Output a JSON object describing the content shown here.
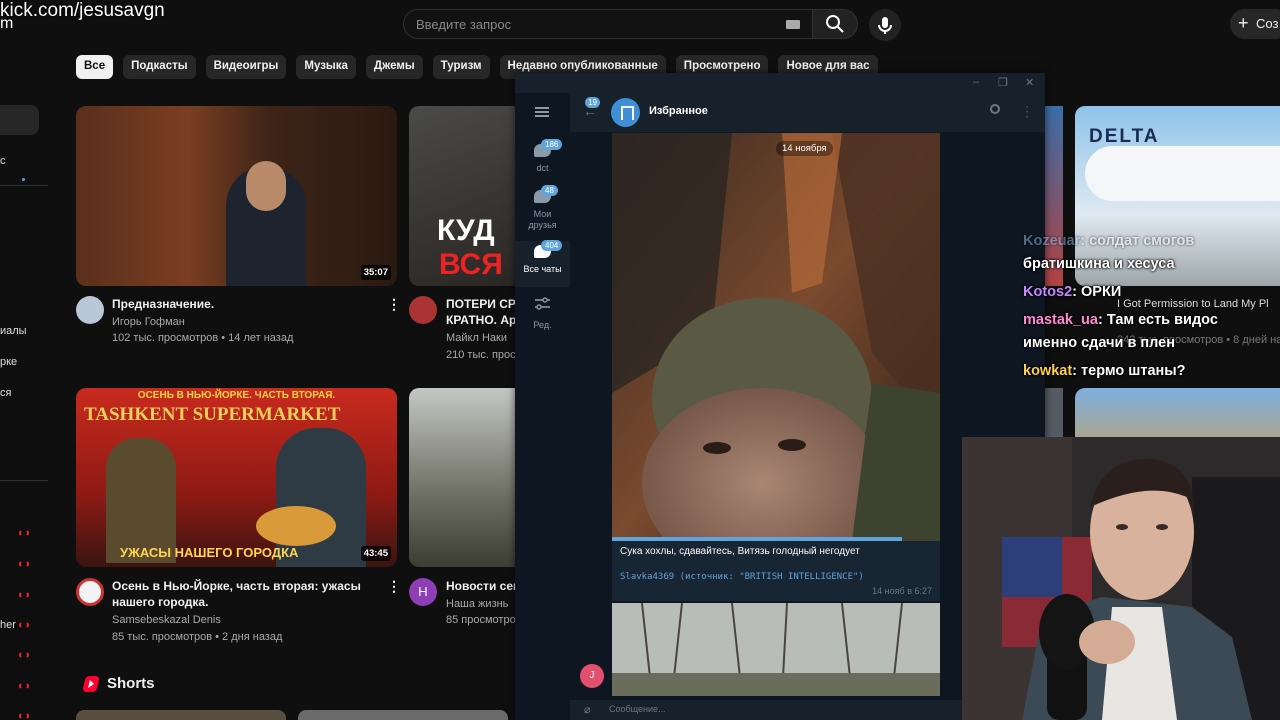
{
  "overlay": {
    "stream_url": "kick.com/jesusavgn",
    "stream_url_tail": "m"
  },
  "header": {
    "search_placeholder": "Введите запрос",
    "create_label": "Соз",
    "create_plus": "+"
  },
  "sidebar": {
    "labels": [
      "иалы",
      "рке",
      "ся",
      "her"
    ]
  },
  "chips": [
    "Все",
    "Подкасты",
    "Видеоигры",
    "Музыка",
    "Джемы",
    "Туризм",
    "Недавно опубликованные",
    "Просмотрено",
    "Новое для вас"
  ],
  "videos": [
    {
      "title": "Предназначение.",
      "channel": "Игорь Гофман",
      "meta": "102 тыс. просмотров • 14 лет назад",
      "duration": "35:07"
    },
    {
      "title": "ПОТЕРИ СРЕ",
      "title2": "КРАТНО. Арі",
      "channel": "Майкл Наки",
      "meta": "210 тыс. просм",
      "thumb_text1": "КУД",
      "thumb_text2": "ВСЯ"
    },
    {
      "title": "Осень в Нью-Йорке, часть вторая: ужасы",
      "title2": "нашего городка.",
      "channel": "Samsebeskazal Denis",
      "meta": "85 тыс. просмотров • 2 дня назад",
      "duration": "43:45",
      "thumb_top": "ОСЕНЬ В НЬЮ-ЙОРКЕ. ЧАСТЬ ВТОРАЯ.",
      "thumb_mid": "TASHKENT SUPERMARKET",
      "thumb_bottom": "УЖАСЫ НАШЕГО ГОРОДКА"
    },
    {
      "title": "Новости сег",
      "channel": "Наша жизнь",
      "meta": "85 просмотро",
      "avatar_letter": "Н"
    }
  ],
  "right_videos": [
    {
      "thumb_text": "DELTA",
      "title": "I Got Permission to Land My Pl",
      "meta": "342 тыс. просмотров • 8 дней наз"
    }
  ],
  "shorts": {
    "title": "Shorts"
  },
  "telegram": {
    "window_buttons": [
      "–",
      "❐",
      "✕"
    ],
    "folders": [
      {
        "label": "dct",
        "badge": "186"
      },
      {
        "label": "Мои друзья",
        "badge": "48"
      },
      {
        "label": "Все чаты",
        "badge": "404"
      },
      {
        "label": "Ред.",
        "badge": ""
      }
    ],
    "back_badge": "19",
    "chat_title": "Избранное",
    "date": "14 ноября",
    "message_text": "Сука хохлы, сдавайтесь, Витязь голодный негодует",
    "forward_from": "Slavka4369 (источник: \"BRITISH INTELLIGENCE\")",
    "message_time": "14 нояб в 6:27",
    "user_avatar_letter": "J",
    "input_placeholder": "Сообщение..."
  },
  "kick_chat": [
    {
      "user": "Kozeuar",
      "text": ": солдат смогов",
      "color": "#ffffff"
    },
    {
      "user": "",
      "text": "братишкина и хесуса",
      "color": "#ffffff"
    },
    {
      "user": "Kotos2",
      "text": ": ОРКИ",
      "color": "#c389ff"
    },
    {
      "user": "mastak_ua",
      "text": ": Там есть видос",
      "color": "#ff8ad0"
    },
    {
      "user": "",
      "text": "именно сдачи в плен",
      "color": "#ffffff"
    },
    {
      "user": "kowkat",
      "text": ": термо штаны?",
      "color": "#ffd04a"
    }
  ],
  "colors": {
    "yt_bg": "#0f0f0f",
    "tg_bg": "#0e1621",
    "tg_accent": "#5fa5dc",
    "live_red": "#ee2233"
  }
}
